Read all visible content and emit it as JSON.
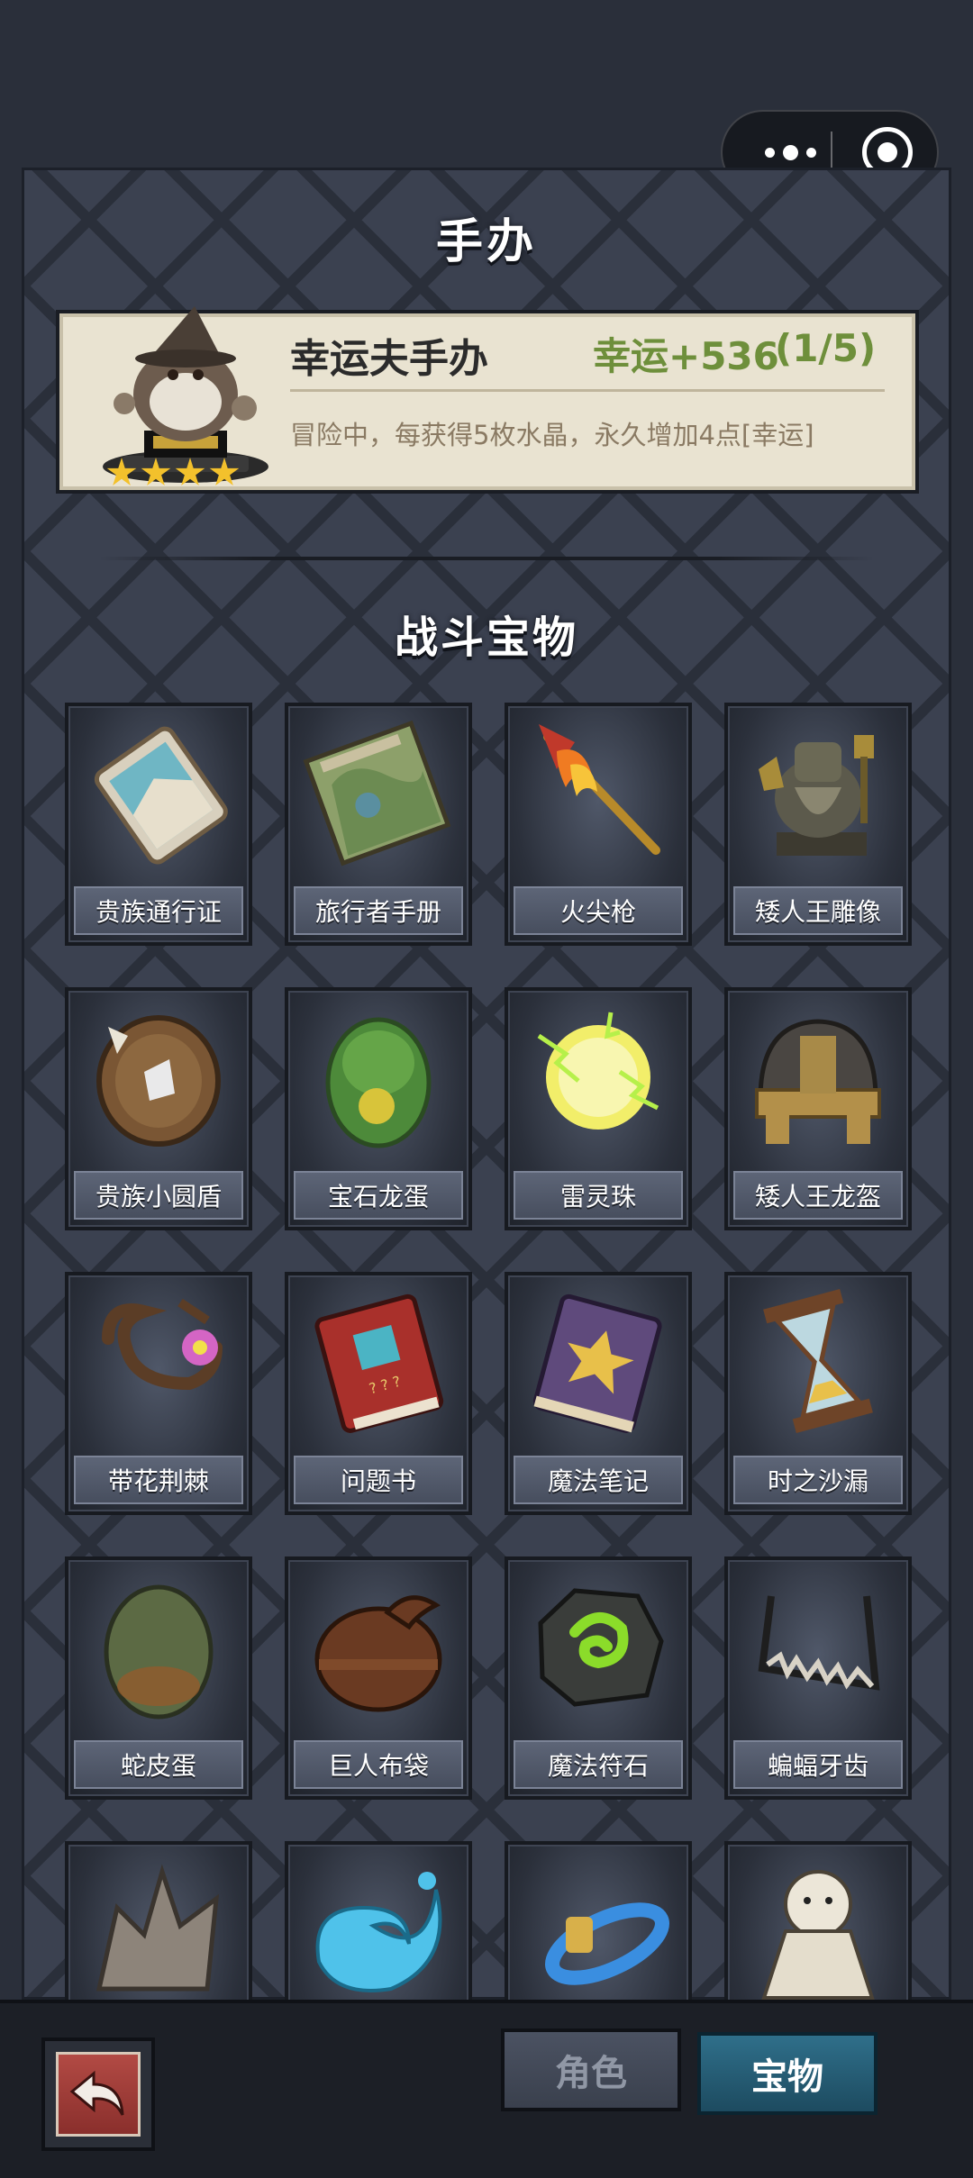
{
  "header": {
    "title": "手办"
  },
  "figure": {
    "name": "幸运夫手办",
    "stat": "幸运+536",
    "progress": "(1/5)",
    "description": "冒险中，每获得5枚水晶，永久增加4点[幸运]",
    "stars": 4,
    "icon": "wizard-figure-icon"
  },
  "section": {
    "title": "战斗宝物"
  },
  "items": [
    {
      "label": "贵族通行证",
      "icon": "pass-card-icon"
    },
    {
      "label": "旅行者手册",
      "icon": "map-book-icon"
    },
    {
      "label": "火尖枪",
      "icon": "fire-spear-icon"
    },
    {
      "label": "矮人王雕像",
      "icon": "dwarf-statue-icon"
    },
    {
      "label": "贵族小圆盾",
      "icon": "round-shield-icon"
    },
    {
      "label": "宝石龙蛋",
      "icon": "gem-egg-icon"
    },
    {
      "label": "雷灵珠",
      "icon": "thunder-orb-icon"
    },
    {
      "label": "矮人王龙盔",
      "icon": "dwarf-helmet-icon"
    },
    {
      "label": "带花荆棘",
      "icon": "thorn-flower-icon"
    },
    {
      "label": "问题书",
      "icon": "red-book-icon"
    },
    {
      "label": "魔法笔记",
      "icon": "magic-notebook-icon"
    },
    {
      "label": "时之沙漏",
      "icon": "hourglass-icon"
    },
    {
      "label": "蛇皮蛋",
      "icon": "snake-egg-icon"
    },
    {
      "label": "巨人布袋",
      "icon": "sack-icon"
    },
    {
      "label": "魔法符石",
      "icon": "rune-stone-icon"
    },
    {
      "label": "蝙蝠牙齿",
      "icon": "bat-teeth-icon"
    },
    {
      "label": "",
      "icon": "spiky-scale-icon"
    },
    {
      "label": "",
      "icon": "water-splash-icon"
    },
    {
      "label": "",
      "icon": "blue-ring-icon"
    },
    {
      "label": "",
      "icon": "ghost-doll-icon"
    }
  ],
  "tabs": {
    "role": "角色",
    "treasure": "宝物"
  },
  "colors": {
    "accent_green": "#6e8f3b",
    "star_gold": "#f3c12c",
    "active_tab": "#2f6f8a"
  }
}
